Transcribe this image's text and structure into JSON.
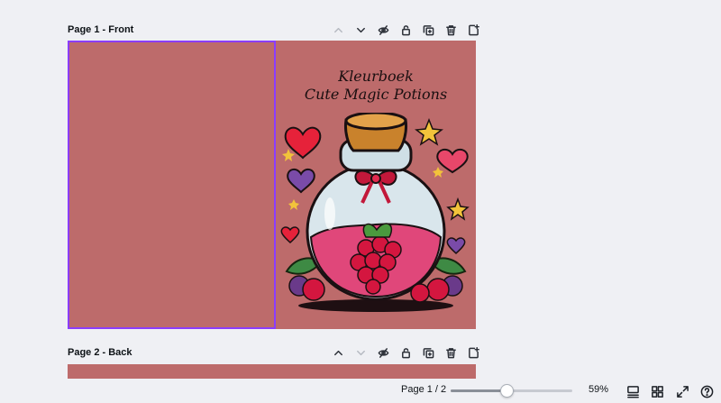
{
  "pages": [
    {
      "title": "Page 1 - Front",
      "actions": [
        "chevron-up-icon",
        "chevron-down-icon",
        "eye-off-icon",
        "lock-icon",
        "duplicate-icon",
        "trash-icon",
        "add-page-icon"
      ],
      "cover": {
        "title_line1": "Kleurboek",
        "title_line2": "Cute Magic Potions"
      },
      "background": "#bd6b6b",
      "selection_color": "#8b3dff"
    },
    {
      "title": "Page 2 - Back",
      "actions": [
        "chevron-up-icon",
        "chevron-down-icon",
        "eye-off-icon",
        "lock-icon",
        "duplicate-icon",
        "trash-icon",
        "add-page-icon"
      ],
      "background": "#bd6b6b"
    }
  ],
  "footer": {
    "page_indicator": "Page 1 / 2",
    "zoom_value": "59%",
    "zoom_fraction": 0.46,
    "tools": [
      "notes-view-icon",
      "grid-view-icon",
      "fullscreen-icon",
      "help-icon"
    ]
  }
}
